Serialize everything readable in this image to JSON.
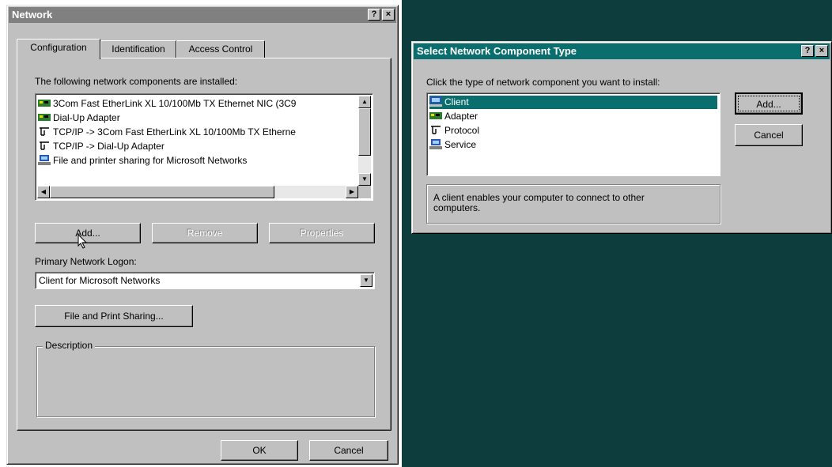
{
  "network": {
    "title": "Network",
    "help_btn": "?",
    "close_btn": "×",
    "tabs": [
      "Configuration",
      "Identification",
      "Access Control"
    ],
    "installed_label": "The following network components are installed:",
    "components": [
      "3Com Fast EtherLink XL 10/100Mb TX Ethernet NIC (3C9",
      "Dial-Up Adapter",
      "TCP/IP -> 3Com Fast EtherLink XL 10/100Mb TX Etherne",
      "TCP/IP -> Dial-Up Adapter",
      "File and printer sharing for Microsoft Networks"
    ],
    "add_btn": "Add...",
    "remove_btn": "Remove",
    "properties_btn": "Properties",
    "primary_logon_label": "Primary Network Logon:",
    "primary_logon_value": "Client for Microsoft Networks",
    "file_print_btn": "File and Print Sharing...",
    "description_label": "Description",
    "ok_btn": "OK",
    "cancel_btn": "Cancel"
  },
  "select_component": {
    "title": "Select Network Component Type",
    "help_btn": "?",
    "close_btn": "×",
    "prompt": "Click the type of network component you want to install:",
    "types": [
      "Client",
      "Adapter",
      "Protocol",
      "Service"
    ],
    "selected_index": 0,
    "description": "A client enables your computer to connect to other computers.",
    "add_btn": "Add...",
    "cancel_btn": "Cancel"
  },
  "colors": {
    "desktop": "#0d3d3d",
    "selection": "#0b6e6e",
    "dialog_face": "#c0c0c0"
  },
  "icons": {
    "nic": "network-card-icon",
    "protocol": "protocol-icon",
    "service": "service-icon",
    "client": "client-icon"
  }
}
